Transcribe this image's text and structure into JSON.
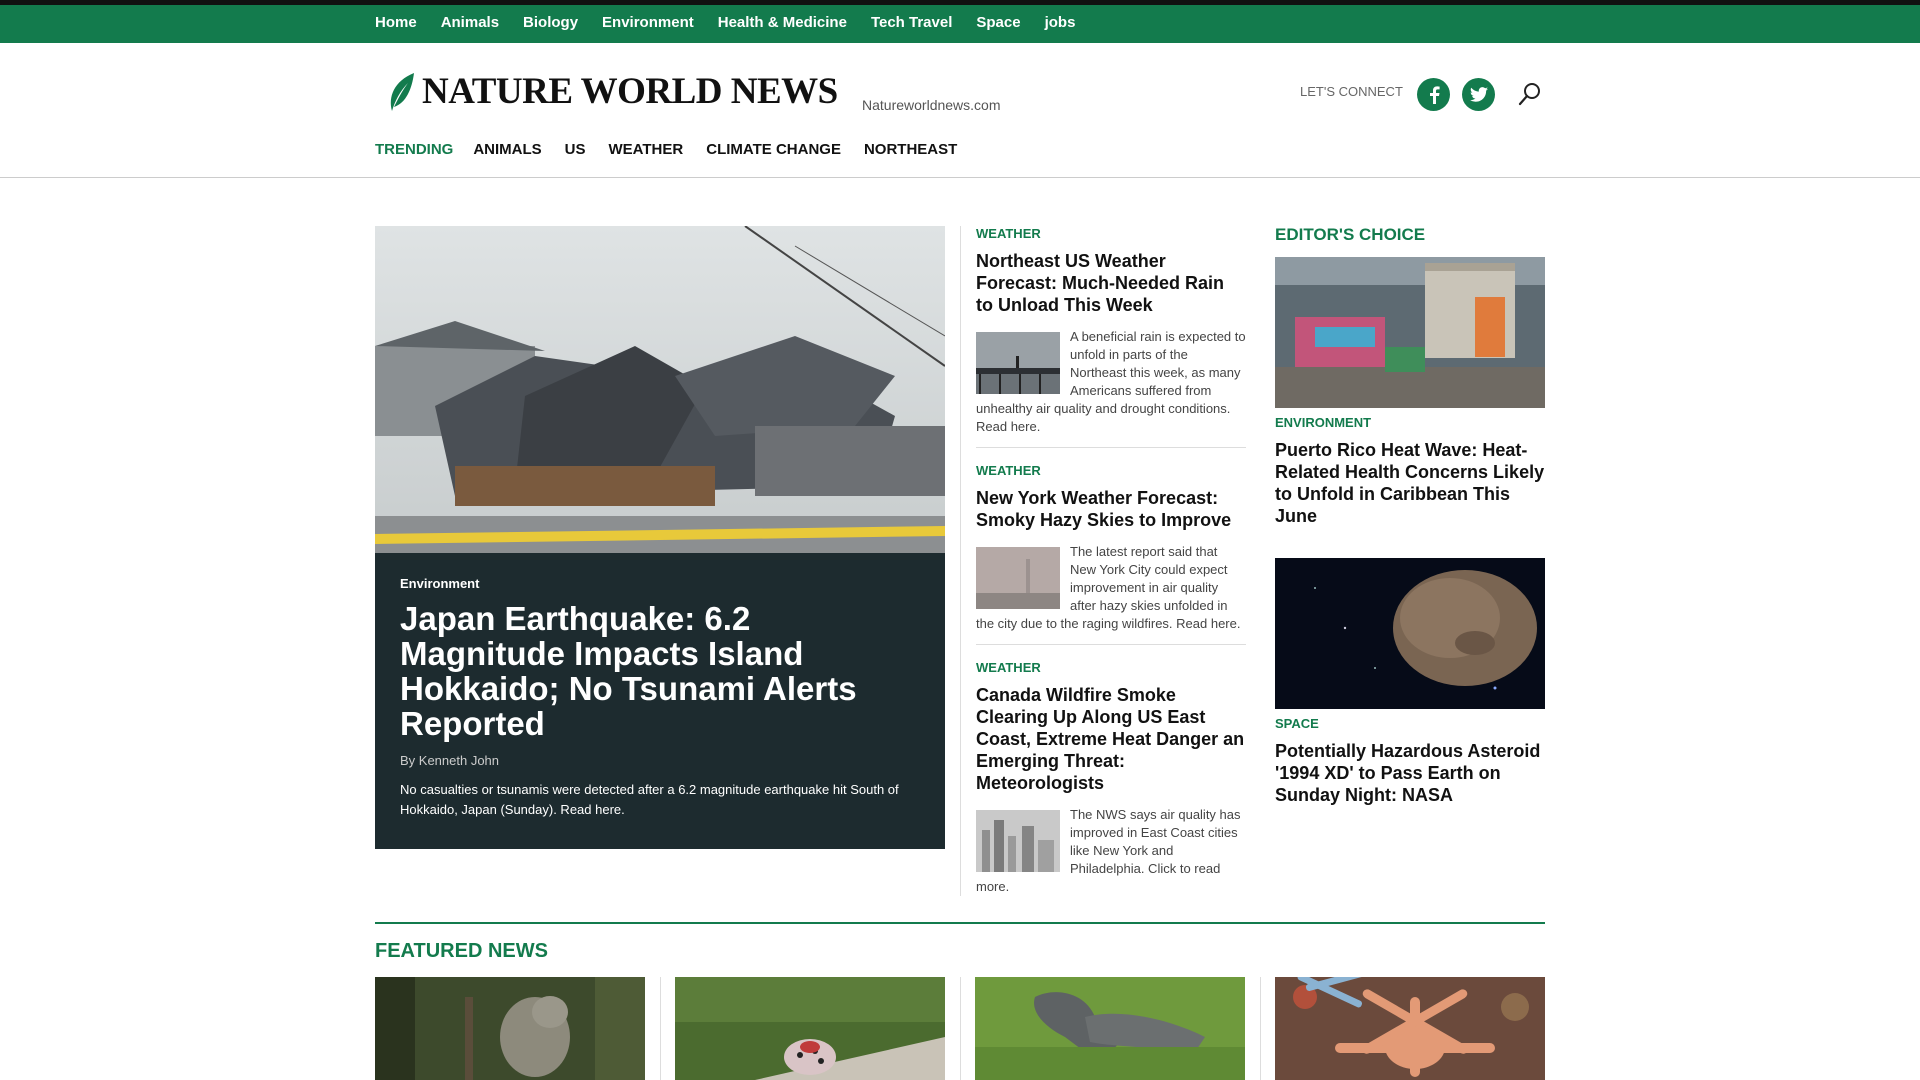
{
  "topnav": [
    "Home",
    "Animals",
    "Biology",
    "Environment",
    "Health & Medicine",
    "Tech Travel",
    "Space",
    "jobs"
  ],
  "header": {
    "logo_text": "NATURE WORLD NEWS",
    "site_url": "Natureworldnews.com",
    "connect_label": "LET'S CONNECT",
    "icons": [
      "leaf-logo-icon",
      "facebook-icon",
      "twitter-icon",
      "search-icon"
    ]
  },
  "secnav": {
    "trending": "TRENDING",
    "items": [
      "ANIMALS",
      "US",
      "WEATHER",
      "CLIMATE CHANGE",
      "NORTHEAST"
    ]
  },
  "hero": {
    "category": "Environment",
    "title": "Japan Earthquake: 6.2 Magnitude Impacts Island Hokkaido; No Tsunami Alerts Reported",
    "byline": "By Kenneth John",
    "description": "No casualties or tsunamis were detected after a 6.2 magnitude earthquake hit South of Hokkaido, Japan (Sunday). Read here."
  },
  "stories": [
    {
      "category": "WEATHER",
      "title": "Northeast US Weather Forecast: Much-Needed Rain to Unload This Week",
      "summary": "A beneficial rain is expected to unfold in parts of the Northeast this week, as many Americans suffered from unhealthy air quality and drought conditions. Read here."
    },
    {
      "category": "WEATHER",
      "title": "New York Weather Forecast: Smoky Hazy Skies to Improve",
      "summary": "The latest report said that New York City could expect improvement in air quality after hazy skies unfolded in the city due to the raging wildfires. Read here."
    },
    {
      "category": "WEATHER",
      "title": "Canada Wildfire Smoke Clearing Up Along US East Coast, Extreme Heat Danger an Emerging Threat: Meteorologists",
      "summary": "The NWS says air quality has improved in East Coast cities like New York and Philadelphia. Click to read more."
    }
  ],
  "editors_choice": {
    "heading": "EDITOR'S CHOICE",
    "items": [
      {
        "category": "ENVIRONMENT",
        "title": "Puerto Rico Heat Wave: Heat-Related Health Concerns Likely to Unfold in Caribbean This June"
      },
      {
        "category": "SPACE",
        "title": "Potentially Hazardous Asteroid '1994 XD' to Pass Earth on Sunday Night: NASA"
      }
    ]
  },
  "featured": {
    "heading": "FEATURED NEWS"
  },
  "colors": {
    "brand_green": "#137b4d",
    "hero_bg": "#1d2b2f"
  }
}
